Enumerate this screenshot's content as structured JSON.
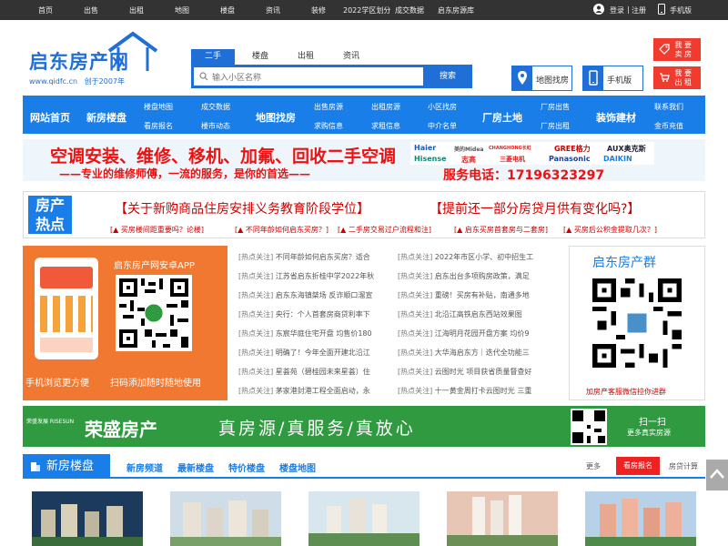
{
  "topbar": {
    "nav": [
      "首页",
      "出售",
      "出租",
      "地图",
      "楼盘",
      "资讯",
      "装修",
      "2022学区划分",
      "成交数据",
      "启东房源库"
    ],
    "login": "登录",
    "sep": "|",
    "register": "注册",
    "mobile": "手机版"
  },
  "logo": {
    "name": "启东房产网",
    "site": "www.qidfc.cn",
    "founded": "创于2007年"
  },
  "search": {
    "tabs": [
      "二手",
      "楼盘",
      "出租",
      "资讯"
    ],
    "active_tab": "二手",
    "placeholder": "输入小区名称",
    "button": "搜索"
  },
  "quick": {
    "map": "地图找房",
    "mobile": "手机版"
  },
  "action_buttons": [
    {
      "l1": "我 要",
      "l2": "卖 房"
    },
    {
      "l1": "我 要",
      "l2": "出 租"
    }
  ],
  "nav": {
    "home": "网站首页",
    "newhouse": "新房楼盘",
    "map": "地图找房",
    "land": "厂房土地",
    "decor": "装饰建材",
    "sub": [
      [
        "楼盘地图",
        "看房报名"
      ],
      [
        "成交数据",
        "楼市动态"
      ],
      [
        "出售房源",
        "求购信息"
      ],
      [
        "出租房源",
        "求租信息"
      ],
      [
        "小区找房",
        "中介名单"
      ],
      [
        "厂房出售",
        "厂房出租"
      ],
      [
        "联系我们",
        "金币充值"
      ]
    ]
  },
  "banner1": {
    "line1": "空调安装、维修、移机、加氟、回收二手空调",
    "line2": "——专业的维修师傅，一流的服务，是你的首选——",
    "phone": "服务电话：17196323297",
    "brands": [
      "Haier",
      "美的Midea",
      "CHANGHONG长虹",
      "GREE格力",
      "AUX奥克斯",
      "Hisense",
      "志高",
      "三菱电机",
      "Panasonic",
      "DAIKIN"
    ]
  },
  "hot": {
    "tag1": "房产",
    "tag2": "热点",
    "headline1": "【关于新购商品住房安排义务教育阶段学位】",
    "headline2": "【提前还一部分房贷月供有变化吗?】",
    "links": [
      "[▲ 买房楼间距重要吗？论楼]",
      "[▲ 不同年龄如何启东买房？]",
      "[▲ 二手房交易过户流程和注]",
      "[▲ 启东买房首套房与二套房]",
      "[▲ 买房后公积金提取几次？]"
    ]
  },
  "app": {
    "title": "启东房产网安卓APP",
    "left_caption": "手机浏览更方便",
    "right_caption": "扫码添加随时随地使用"
  },
  "news_prefix": "[热点关注]",
  "news_left": [
    "不同年龄如何启东买房？适合",
    "江苏省启东折桂中学2022年秋",
    "启东东海镇桀场 反诈顺口溜宣",
    "央行：个人首套房商贷利率下",
    "东宸华庭住宅开盘 均售价180",
    "明确了！今年全面开建北沿江",
    "星荟苑（碧桂园未来星荟）住",
    "茅家港封港工程全面启动，永"
  ],
  "news_right": [
    "2022年市区小学、初中招生工",
    "启东出台多项购房政策，满足",
    "重磅！买房有补贴，南通多地",
    "北沿江高铁启东西站效果图",
    "江海明月花园开盘方案 均价9",
    "大华海启东方｜迭代全功能三",
    "云图时光 项目获省质量督查好",
    "十一黄金周打卡云图时光 三重"
  ],
  "group": {
    "title": "启东房产群",
    "caption": "加房产客服微信拉你进群"
  },
  "banner2": {
    "small": "荣盛发展 RISESUN",
    "brand": "荣盛房产",
    "slogan": "真房源/真服务/真放心",
    "scan": "扫一扫",
    "scan_sub": "更多真实房源"
  },
  "section": {
    "title": "新房楼盘",
    "tabs": [
      "新房频道",
      "最新楼盘",
      "特价楼盘",
      "楼盘地图"
    ],
    "more": "更多",
    "register": "看房报名",
    "calc": "房贷计算"
  },
  "colors": {
    "accent": "#1a7ee8",
    "red": "#f03b2e",
    "orange": "#f07830",
    "green": "#2f9a3f"
  }
}
